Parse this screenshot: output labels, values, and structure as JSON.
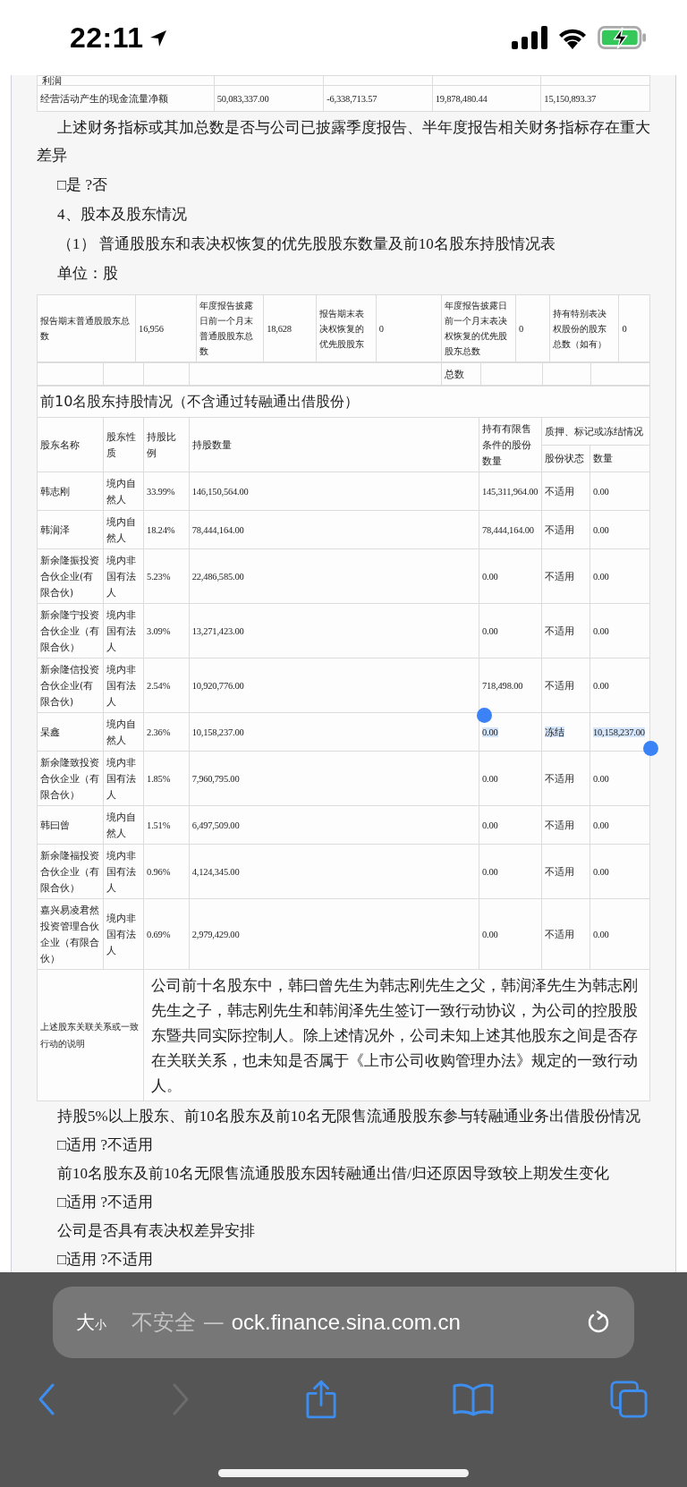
{
  "status_bar": {
    "time": "22:11"
  },
  "top_table": {
    "partial_row": {
      "label": "利润"
    },
    "cash_flow_row": {
      "label": "经营活动产生的现金流量净额",
      "values": [
        "50,083,337.00",
        "-6,338,713.57",
        "19,878,480.44",
        "15,150,893.37"
      ]
    }
  },
  "paragraphs_before": [
    "上述财务指标或其加总数是否与公司已披露季度报告、半年度报告相关财务指标存在重大差异",
    "□是 ?否",
    "4、股本及股东情况",
    "（1） 普通股股东和表决权恢复的优先股股东数量及前10名股东持股情况表",
    "单位：股"
  ],
  "summary": {
    "items": [
      {
        "label": "报告期末普通股股东总数",
        "value": "16,956"
      },
      {
        "label": "年度报告披露日前一个月末普通股股东总数",
        "value": "18,628"
      },
      {
        "label": "报告期末表决权恢复的优先股股东",
        "value": "0"
      },
      {
        "label": "年度报告披露日前一个月末表决权恢复的优先股股东总数",
        "value": "0"
      },
      {
        "label": "持有特别表决权股份的股东总数（如有）",
        "value": "0"
      }
    ],
    "second_row_label": "总数"
  },
  "holders": {
    "title": "前10名股东持股情况（不含通过转融通出借股份）",
    "columns": {
      "name": "股东名称",
      "nature": "股东性质",
      "ratio": "持股比例",
      "count": "持股数量",
      "restricted": "持有有限售条件的股份数量",
      "pledge": "质押、标记或冻结情况",
      "status": "股份状态",
      "quantity": "数量"
    },
    "rows": [
      {
        "name": "韩志刚",
        "nature": "境内自然人",
        "ratio": "33.99%",
        "count": "146,150,564.00",
        "restricted": "145,311,964.00",
        "status": "不适用",
        "quantity": "0.00",
        "text_selected": false
      },
      {
        "name": "韩润泽",
        "nature": "境内自然人",
        "ratio": "18.24%",
        "count": "78,444,164.00",
        "restricted": "78,444,164.00",
        "status": "不适用",
        "quantity": "0.00",
        "text_selected": false
      },
      {
        "name": "新余隆振投资合伙企业(有限合伙)",
        "nature": "境内非国有法人",
        "ratio": "5.23%",
        "count": "22,486,585.00",
        "restricted": "0.00",
        "status": "不适用",
        "quantity": "0.00",
        "text_selected": false
      },
      {
        "name": "新余隆宁投资合伙企业（有限合伙）",
        "nature": "境内非国有法人",
        "ratio": "3.09%",
        "count": "13,271,423.00",
        "restricted": "0.00",
        "status": "不适用",
        "quantity": "0.00",
        "text_selected": false
      },
      {
        "name": "新余隆信投资合伙企业(有限合伙)",
        "nature": "境内非国有法人",
        "ratio": "2.54%",
        "count": "10,920,776.00",
        "restricted": "718,498.00",
        "status": "不适用",
        "quantity": "0.00",
        "text_selected": false
      },
      {
        "name": "杲鑫",
        "nature": "境内自然人",
        "ratio": "2.36%",
        "count": "10,158,237.00",
        "restricted": "0.00",
        "status": "冻结",
        "quantity": "10,158,237.00",
        "text_selected": true
      },
      {
        "name": "新余隆致投资合伙企业（有限合伙）",
        "nature": "境内非国有法人",
        "ratio": "1.85%",
        "count": "7,960,795.00",
        "restricted": "0.00",
        "status": "不适用",
        "quantity": "0.00",
        "text_selected": false
      },
      {
        "name": "韩曰曾",
        "nature": "境内自然人",
        "ratio": "1.51%",
        "count": "6,497,509.00",
        "restricted": "0.00",
        "status": "不适用",
        "quantity": "0.00",
        "text_selected": false
      },
      {
        "name": "新余隆福投资合伙企业（有限合伙）",
        "nature": "境内非国有法人",
        "ratio": "0.96%",
        "count": "4,124,345.00",
        "restricted": "0.00",
        "status": "不适用",
        "quantity": "0.00",
        "text_selected": false
      },
      {
        "name": "嘉兴易凌君然投资管理合伙企业（有限合伙）",
        "nature": "境内非国有法人",
        "ratio": "0.69%",
        "count": "2,979,429.00",
        "restricted": "0.00",
        "status": "不适用",
        "quantity": "0.00",
        "text_selected": false
      }
    ],
    "note": {
      "label": "上述股东关联关系或一致行动的说明",
      "text": "公司前十名股东中，韩曰曾先生为韩志刚先生之父，韩润泽先生为韩志刚先生之子，韩志刚先生和韩润泽先生签订一致行动协议，为公司的控股股东暨共同实际控制人。除上述情况外，公司未知上述其他股东之间是否存在关联关系，也未知是否属于《上市公司收购管理办法》规定的一致行动人。"
    }
  },
  "paragraphs_after": [
    "持股5%以上股东、前10名股东及前10名无限售流通股股东参与转融通业务出借股份情况",
    "□适用 ?不适用",
    "前10名股东及前10名无限售流通股股东因转融通出借/归还原因导致较上期发生变化",
    "□适用 ?不适用",
    "公司是否具有表决权差异安排",
    "□适用 ?不适用"
  ],
  "browser": {
    "text_size_button": {
      "large": "大",
      "small": "小"
    },
    "url_prefix": "不安全 —",
    "url_host": "ock.finance.sina.com.cn",
    "toolbar": {
      "back_enabled": true,
      "forward_enabled": false
    }
  }
}
